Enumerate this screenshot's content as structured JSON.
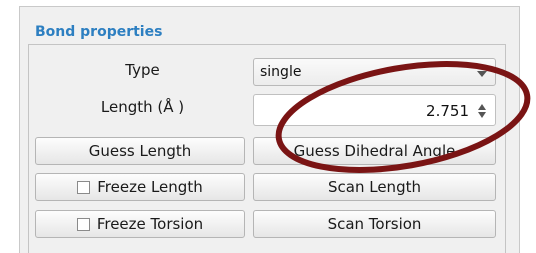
{
  "group": {
    "title": "Bond properties"
  },
  "type_row": {
    "label": "Type",
    "value": "single"
  },
  "length_row": {
    "label": "Length (Å )",
    "value": "2.751"
  },
  "buttons": {
    "guess_length": "Guess Length",
    "guess_dihedral": "Guess Dihedral Angle",
    "freeze_length": "Freeze Length",
    "scan_length": "Scan Length",
    "freeze_torsion": "Freeze Torsion",
    "scan_torsion": "Scan Torsion"
  },
  "colors": {
    "group_title": "#2d7fc1",
    "annotation_ellipse": "#7a1414"
  }
}
